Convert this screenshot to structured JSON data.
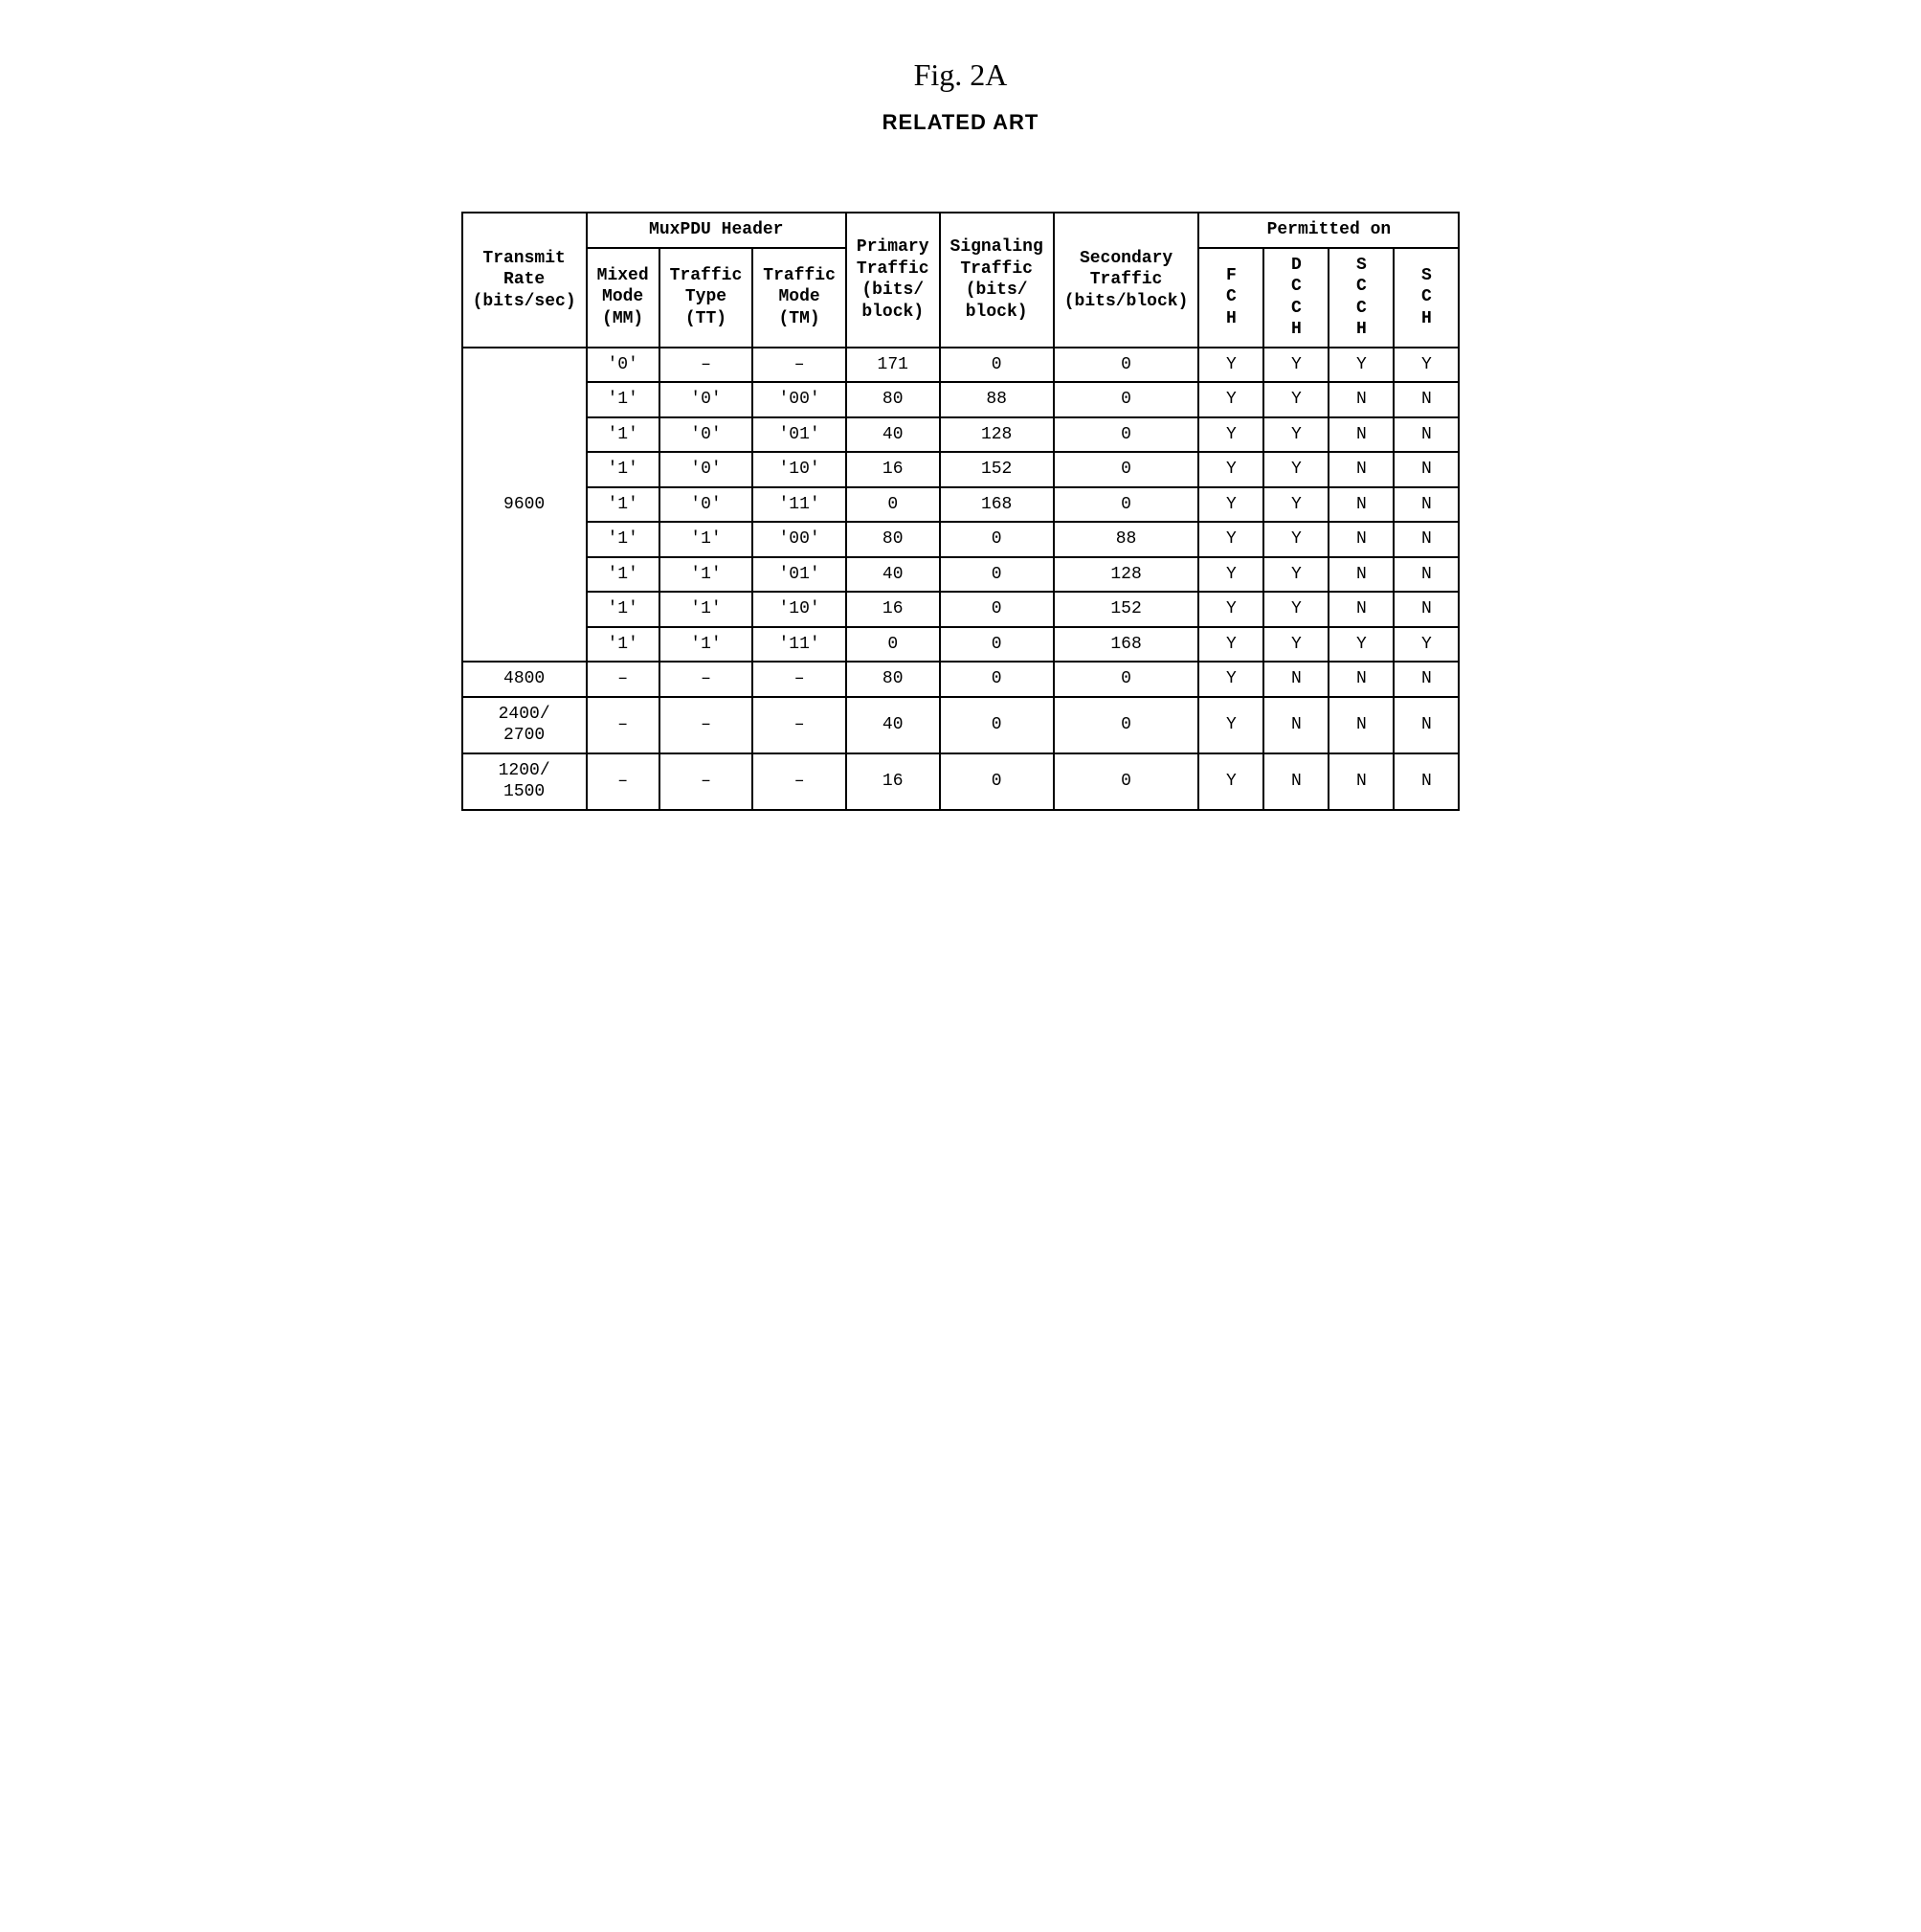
{
  "title": "Fig. 2A",
  "subtitle": "RELATED  ART",
  "headers": {
    "muxpdu": "MuxPDU Header",
    "permitted": "Permitted on",
    "transmit_rate": "Transmit\nRate\n(bits/sec)",
    "mm": "Mixed\nMode\n(MM)",
    "tt": "Traffic\nType\n(TT)",
    "tm": "Traffic\nMode\n(TM)",
    "primary": "Primary\nTraffic\n(bits/\nblock)",
    "signaling": "Signaling\nTraffic\n(bits/\nblock)",
    "secondary": "Secondary\nTraffic\n(bits/block)",
    "fch": "F\nC\nH",
    "dcch": "D\nC\nC\nH",
    "scch": "S\nC\nC\nH",
    "sch": "S\nC\nH"
  },
  "rows": [
    {
      "rate": "9600",
      "mm": "'0'",
      "tt": "–",
      "tm": "–",
      "primary": "171",
      "signaling": "0",
      "secondary": "0",
      "fch": "Y",
      "dcch": "Y",
      "scch": "Y",
      "sch": "Y"
    },
    {
      "rate": "",
      "mm": "'1'",
      "tt": "'0'",
      "tm": "'00'",
      "primary": "80",
      "signaling": "88",
      "secondary": "0",
      "fch": "Y",
      "dcch": "Y",
      "scch": "N",
      "sch": "N"
    },
    {
      "rate": "",
      "mm": "'1'",
      "tt": "'0'",
      "tm": "'01'",
      "primary": "40",
      "signaling": "128",
      "secondary": "0",
      "fch": "Y",
      "dcch": "Y",
      "scch": "N",
      "sch": "N"
    },
    {
      "rate": "",
      "mm": "'1'",
      "tt": "'0'",
      "tm": "'10'",
      "primary": "16",
      "signaling": "152",
      "secondary": "0",
      "fch": "Y",
      "dcch": "Y",
      "scch": "N",
      "sch": "N"
    },
    {
      "rate": "",
      "mm": "'1'",
      "tt": "'0'",
      "tm": "'11'",
      "primary": "0",
      "signaling": "168",
      "secondary": "0",
      "fch": "Y",
      "dcch": "Y",
      "scch": "N",
      "sch": "N"
    },
    {
      "rate": "",
      "mm": "'1'",
      "tt": "'1'",
      "tm": "'00'",
      "primary": "80",
      "signaling": "0",
      "secondary": "88",
      "fch": "Y",
      "dcch": "Y",
      "scch": "N",
      "sch": "N"
    },
    {
      "rate": "",
      "mm": "'1'",
      "tt": "'1'",
      "tm": "'01'",
      "primary": "40",
      "signaling": "0",
      "secondary": "128",
      "fch": "Y",
      "dcch": "Y",
      "scch": "N",
      "sch": "N"
    },
    {
      "rate": "",
      "mm": "'1'",
      "tt": "'1'",
      "tm": "'10'",
      "primary": "16",
      "signaling": "0",
      "secondary": "152",
      "fch": "Y",
      "dcch": "Y",
      "scch": "N",
      "sch": "N"
    },
    {
      "rate": "",
      "mm": "'1'",
      "tt": "'1'",
      "tm": "'11'",
      "primary": "0",
      "signaling": "0",
      "secondary": "168",
      "fch": "Y",
      "dcch": "Y",
      "scch": "Y",
      "sch": "Y"
    },
    {
      "rate": "4800",
      "mm": "–",
      "tt": "–",
      "tm": "–",
      "primary": "80",
      "signaling": "0",
      "secondary": "0",
      "fch": "Y",
      "dcch": "N",
      "scch": "N",
      "sch": "N"
    },
    {
      "rate": "2400/\n2700",
      "mm": "–",
      "tt": "–",
      "tm": "–",
      "primary": "40",
      "signaling": "0",
      "secondary": "0",
      "fch": "Y",
      "dcch": "N",
      "scch": "N",
      "sch": "N"
    },
    {
      "rate": "1200/\n1500",
      "mm": "–",
      "tt": "–",
      "tm": "–",
      "primary": "16",
      "signaling": "0",
      "secondary": "0",
      "fch": "Y",
      "dcch": "N",
      "scch": "N",
      "sch": "N"
    }
  ]
}
